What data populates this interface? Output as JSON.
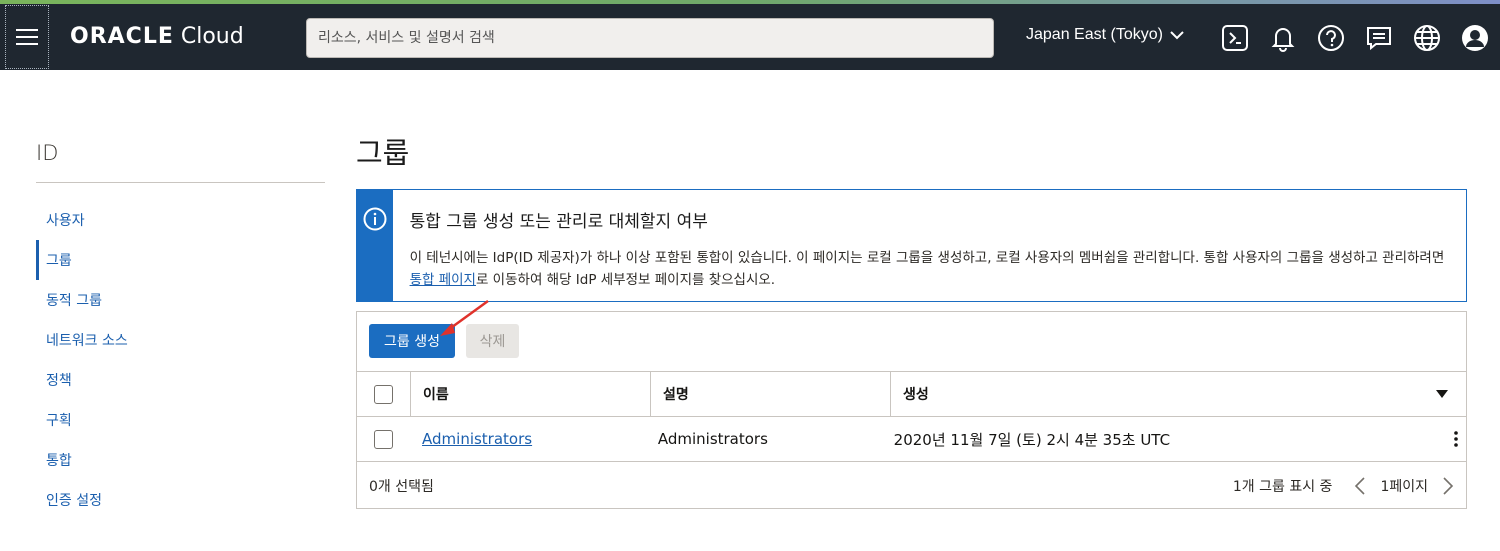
{
  "header": {
    "brand_oracle": "ORACLE",
    "brand_cloud": "Cloud",
    "search_placeholder": "리소스, 서비스 및 설명서 검색",
    "region": "Japan East (Tokyo)",
    "icons": [
      "menu-icon",
      "cloud-shell-icon",
      "bell-icon",
      "help-icon",
      "chat-icon",
      "globe-icon",
      "user-profile-icon"
    ]
  },
  "sidebar": {
    "title": "ID",
    "items": [
      {
        "label": "사용자"
      },
      {
        "label": "그룹"
      },
      {
        "label": "동적 그룹"
      },
      {
        "label": "네트워크 소스"
      },
      {
        "label": "정책"
      },
      {
        "label": "구획"
      },
      {
        "label": "통합"
      },
      {
        "label": "인증 설정"
      }
    ],
    "active": "그룹"
  },
  "main": {
    "title": "그룹",
    "info": {
      "title": "통합 그룹 생성 또는 관리로 대체할지 여부",
      "text_before": "이 테넌시에는 IdP(ID 제공자)가 하나 이상 포함된 통합이 있습니다. 이 페이지는 로컬 그룹을 생성하고, 로컬 사용자의 멤버쉽을 관리합니다. 통합 사용자의 그룹을 생성하고 관리하려면 ",
      "link": "통합 페이지",
      "text_after": "로 이동하여 해당 IdP 세부정보 페이지를 찾으십시오."
    },
    "toolbar": {
      "create_label": "그룹 생성",
      "delete_label": "삭제"
    },
    "table": {
      "columns": [
        "이름",
        "설명",
        "생성"
      ],
      "rows": [
        {
          "name": "Administrators",
          "description": "Administrators",
          "created": "2020년 11월 7일 (토) 2시 4분 35초 UTC"
        }
      ]
    },
    "footer": {
      "selected": "0개 선택됨",
      "showing": "1개 그룹 표시 중",
      "page": "1페이지"
    }
  },
  "colors": {
    "header_bg": "#1f2730",
    "accent": "#1b6dc1",
    "link": "#1b5fae",
    "annotation": "#e0322b"
  }
}
